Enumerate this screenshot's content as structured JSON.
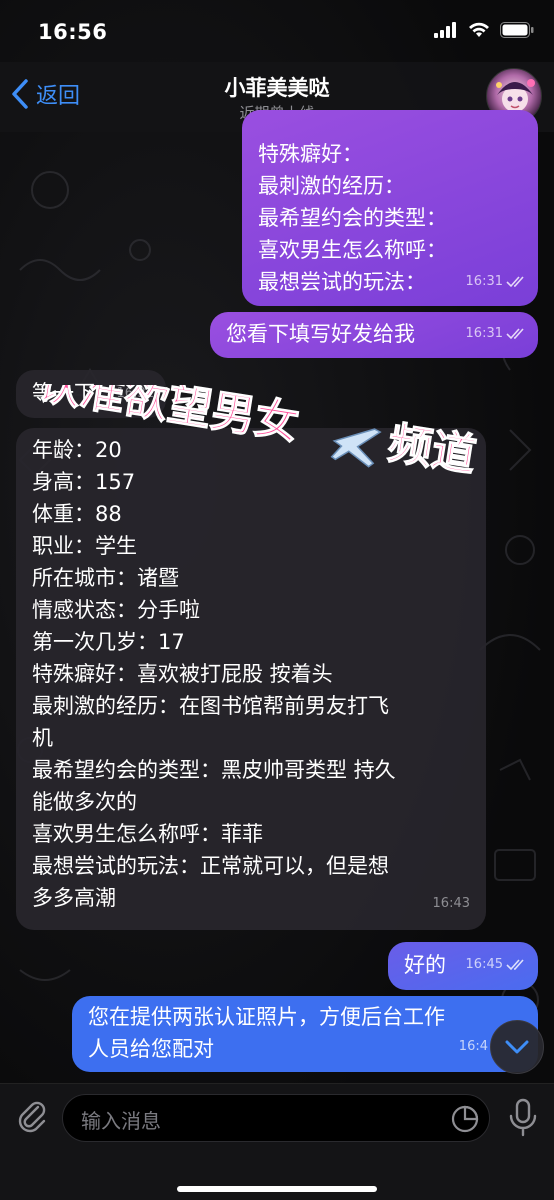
{
  "status_bar": {
    "time": "16:56"
  },
  "nav": {
    "back_label": "返回",
    "title": "小菲美美哒",
    "subtitle": "近期曾上线"
  },
  "messages": {
    "out_1": {
      "lines": [
        "特殊癖好：",
        "最刺激的经历：",
        "最希望约会的类型：",
        "喜欢男生怎么称呼：",
        "最想尝试的玩法："
      ],
      "time": "16:31"
    },
    "out_2": {
      "text": "您看下填写好发给我",
      "time": "16:31"
    },
    "in_1": {
      "text": "等一下",
      "time": "16:31"
    },
    "in_2": {
      "lines": [
        "年龄：20",
        "身高：157",
        "体重：88",
        "职业：学生",
        "所在城市：诸暨",
        "情感状态：分手啦",
        "第一次几岁：17",
        "特殊癖好：喜欢被打屁股 按着头",
        "最刺激的经历：在图书馆帮前男友打飞",
        "机",
        "最希望约会的类型：黑皮帅哥类型 持久",
        "能做多次的",
        "喜欢男生怎么称呼：菲菲",
        "最想尝试的玩法：正常就可以，但是想",
        "多多高潮"
      ],
      "time": "16:43"
    },
    "out_3": {
      "text": "好的",
      "time": "16:45"
    },
    "out_4": {
      "lines": [
        "您在提供两张认证照片，方便后台工作",
        "人员给您配对"
      ],
      "time": "16:4"
    }
  },
  "watermark": {
    "text_part1": "认准欲望男女",
    "text_part2": "频道",
    "icon": "airplane-icon"
  },
  "input": {
    "placeholder": "输入消息"
  },
  "colors": {
    "accent": "#3e8ef7",
    "bubble_out": "#8a46dc",
    "bubble_out_blue": "#3d6ff0",
    "bubble_in": "#28262c",
    "watermark": "#ff4f9a"
  }
}
